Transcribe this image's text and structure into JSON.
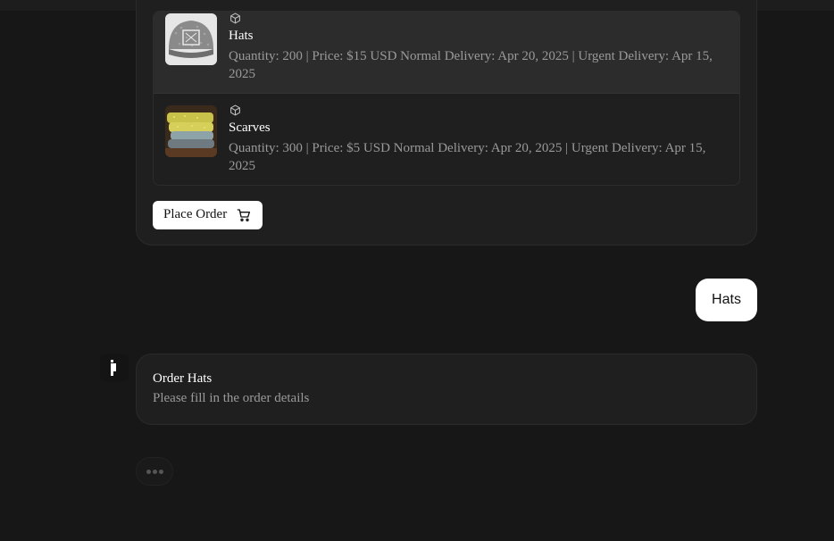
{
  "products": [
    {
      "name": "Hats",
      "details": "Quantity: 200 | Price: $15 USD Normal Delivery: Apr 20, 2025 | Urgent Delivery: Apr 15, 2025",
      "thumb_icon": "hat-image",
      "type_icon": "package-icon"
    },
    {
      "name": "Scarves",
      "details": "Quantity: 300 | Price: $5 USD Normal Delivery: Apr 20, 2025 | Urgent Delivery: Apr 15, 2025",
      "thumb_icon": "scarves-image",
      "type_icon": "package-icon"
    }
  ],
  "place_order": {
    "label": "Place Order",
    "icon": "shopping-cart-icon"
  },
  "user_message": {
    "text": "Hats"
  },
  "order_form": {
    "title": "Order Hats",
    "subtitle": "Please fill in the order details"
  },
  "typing_indicator": {
    "icon": "typing-dots-icon"
  },
  "colors": {
    "background": "#171717",
    "card": "#1f1f1f",
    "selected_row": "#2c2c2c",
    "text_primary": "#ffffff",
    "text_secondary": "#9a9a9a",
    "button_bg": "#ffffff"
  }
}
